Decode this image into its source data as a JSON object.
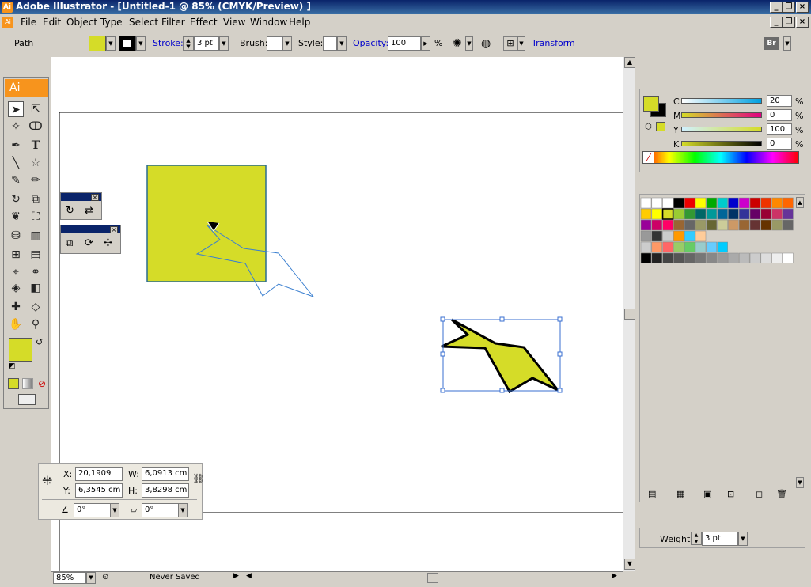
{
  "window": {
    "app_icon": "Ai",
    "title": "Adobe Illustrator - [Untitled-1 @ 85% (CMYK/Preview) ]"
  },
  "menu": [
    "File",
    "Edit",
    "Object",
    "Type",
    "Select",
    "Filter",
    "Effect",
    "View",
    "Window",
    "Help"
  ],
  "control": {
    "selection_label": "Path",
    "stroke_label": "Stroke:",
    "stroke_value": "3 pt",
    "brush_label": "Brush:",
    "style_label": "Style:",
    "opacity_label": "Opacity:",
    "opacity_value": "100",
    "opacity_unit": "%",
    "transform_label": "Transform",
    "bridge_label": "Br"
  },
  "colors": {
    "fill": "#d5dc28",
    "selection": "#3a6fd0",
    "title_blue": "#0a246a"
  },
  "toolbox": {
    "logo": "Ai"
  },
  "color_panel": {
    "channels": [
      {
        "label": "C",
        "value": "20",
        "unit": "%"
      },
      {
        "label": "M",
        "value": "0",
        "unit": "%"
      },
      {
        "label": "Y",
        "value": "100",
        "unit": "%"
      },
      {
        "label": "K",
        "value": "0",
        "unit": "%"
      }
    ]
  },
  "transform": {
    "x_label": "X:",
    "x_value": "20,1909 cm",
    "y_label": "Y:",
    "y_value": "6,3545 cm",
    "w_label": "W:",
    "w_value": "6,0913 cm",
    "h_label": "H:",
    "h_value": "3,8298 cm",
    "rotate_value": "0°",
    "shear_value": "0°"
  },
  "stroke_panel": {
    "weight_label": "Weight:",
    "weight_value": "3 pt"
  },
  "status": {
    "zoom": "85%",
    "status_text": "Never Saved"
  }
}
